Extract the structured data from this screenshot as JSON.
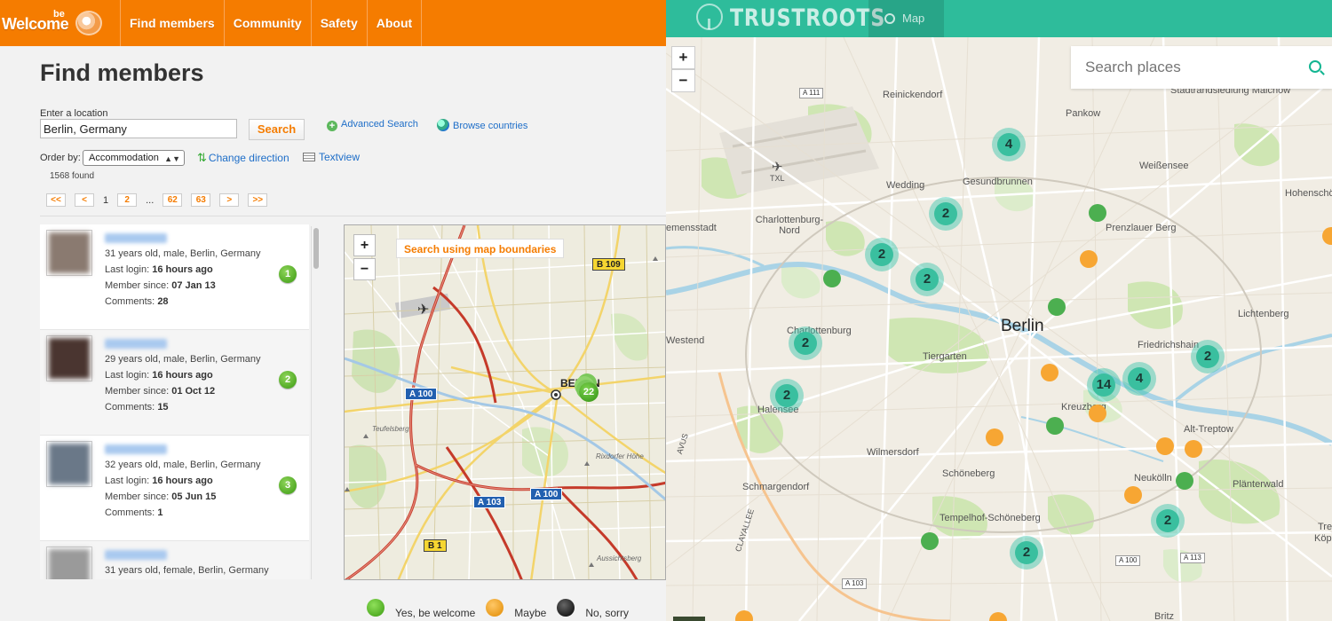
{
  "bewelcome": {
    "logo": {
      "word": "Welcome",
      "superscript": "be"
    },
    "nav": [
      {
        "label": "Find members",
        "key": "find-members"
      },
      {
        "label": "Community",
        "key": "community"
      },
      {
        "label": "Safety",
        "key": "safety"
      },
      {
        "label": "About",
        "key": "about"
      }
    ],
    "page_title": "Find members",
    "location_label": "Enter a location",
    "location_value": "Berlin, Germany",
    "search_label": "Search",
    "advanced_search": "Advanced Search",
    "browse_countries": "Browse countries",
    "order_label": "Order by:",
    "order_value": "Accommodation",
    "change_direction": "Change direction",
    "textview": "Textview",
    "found": "1568 found",
    "pager": {
      "first": "<<",
      "prev": "<",
      "current": "1",
      "page2": "2",
      "ellipsis": "...",
      "page62": "62",
      "page63": "63",
      "next": ">",
      "last": ">>"
    },
    "results": [
      {
        "details": "31 years old, male, Berlin, Germany",
        "login_label": "Last login:",
        "login": "16 hours ago",
        "since_label": "Member since:",
        "since": "07 Jan 13",
        "comments_label": "Comments:",
        "comments": "28",
        "number": "1",
        "photo_color": "#8a7a70"
      },
      {
        "details": "29 years old, male, Berlin, Germany",
        "login_label": "Last login:",
        "login": "16 hours ago",
        "since_label": "Member since:",
        "since": "01 Oct 12",
        "comments_label": "Comments:",
        "comments": "15",
        "number": "2",
        "photo_color": "#4a3530"
      },
      {
        "details": "32 years old, male, Berlin, Germany",
        "login_label": "Last login:",
        "login": "16 hours ago",
        "since_label": "Member since:",
        "since": "05 Jun 15",
        "comments_label": "Comments:",
        "comments": "1",
        "number": "3",
        "photo_color": "#6a7888"
      },
      {
        "details": "31 years old, female, Berlin, Germany",
        "photo_color": "#9a9a9a"
      }
    ],
    "map": {
      "zoom_in": "+",
      "zoom_out": "−",
      "search_boundaries": "Search using map boundaries",
      "city": "BERLIN",
      "cluster_count": "22",
      "road_badges": [
        "B 109",
        "A 100",
        "A 100",
        "A 103",
        "B 1"
      ],
      "places": [
        "Teufelsberg",
        "Rixdorfer Höhe",
        "Aussichtsberg"
      ]
    },
    "legend": [
      {
        "label": "Yes, be welcome",
        "color": "#4caf1f"
      },
      {
        "label": "Maybe",
        "color": "#f7a31c"
      },
      {
        "label": "No, sorry",
        "color": "#222222"
      }
    ],
    "accent_color": "#f57c00"
  },
  "trustroots": {
    "brand": "TRUSTROOTS",
    "nav_map": "Map",
    "zoom_in": "+",
    "zoom_out": "−",
    "search_placeholder": "Search places",
    "city": "Berlin",
    "labels": [
      "Reinickendorf",
      "Pankow",
      "Stadtrandsiedlung Malchow",
      "Weißensee",
      "Hohenschö",
      "Gesundbrunnen",
      "Wedding",
      "Prenzlauer Berg",
      "Charlottenburg-Nord",
      "emensstadt",
      "TXL",
      "Lichtenberg",
      "Westend",
      "Charlottenburg",
      "Friedrichshain",
      "Tiergarten",
      "Alt-Treptow",
      "Halensee",
      "Kreuzberg",
      "Wilmersdorf",
      "Schöneberg",
      "Neukölln",
      "Plänterwald",
      "Schmargendorf",
      "Tempelhof-Schöneberg",
      "AVUS",
      "CLAYALLEE",
      "Britz",
      "Trep",
      "Köpe"
    ],
    "shields": [
      "A 111",
      "A 100",
      "A 113",
      "A 103"
    ],
    "clusters": [
      "4",
      "2",
      "2",
      "2",
      "2",
      "14",
      "4",
      "2",
      "2",
      "2",
      "2"
    ],
    "accent_color": "#12b591"
  }
}
